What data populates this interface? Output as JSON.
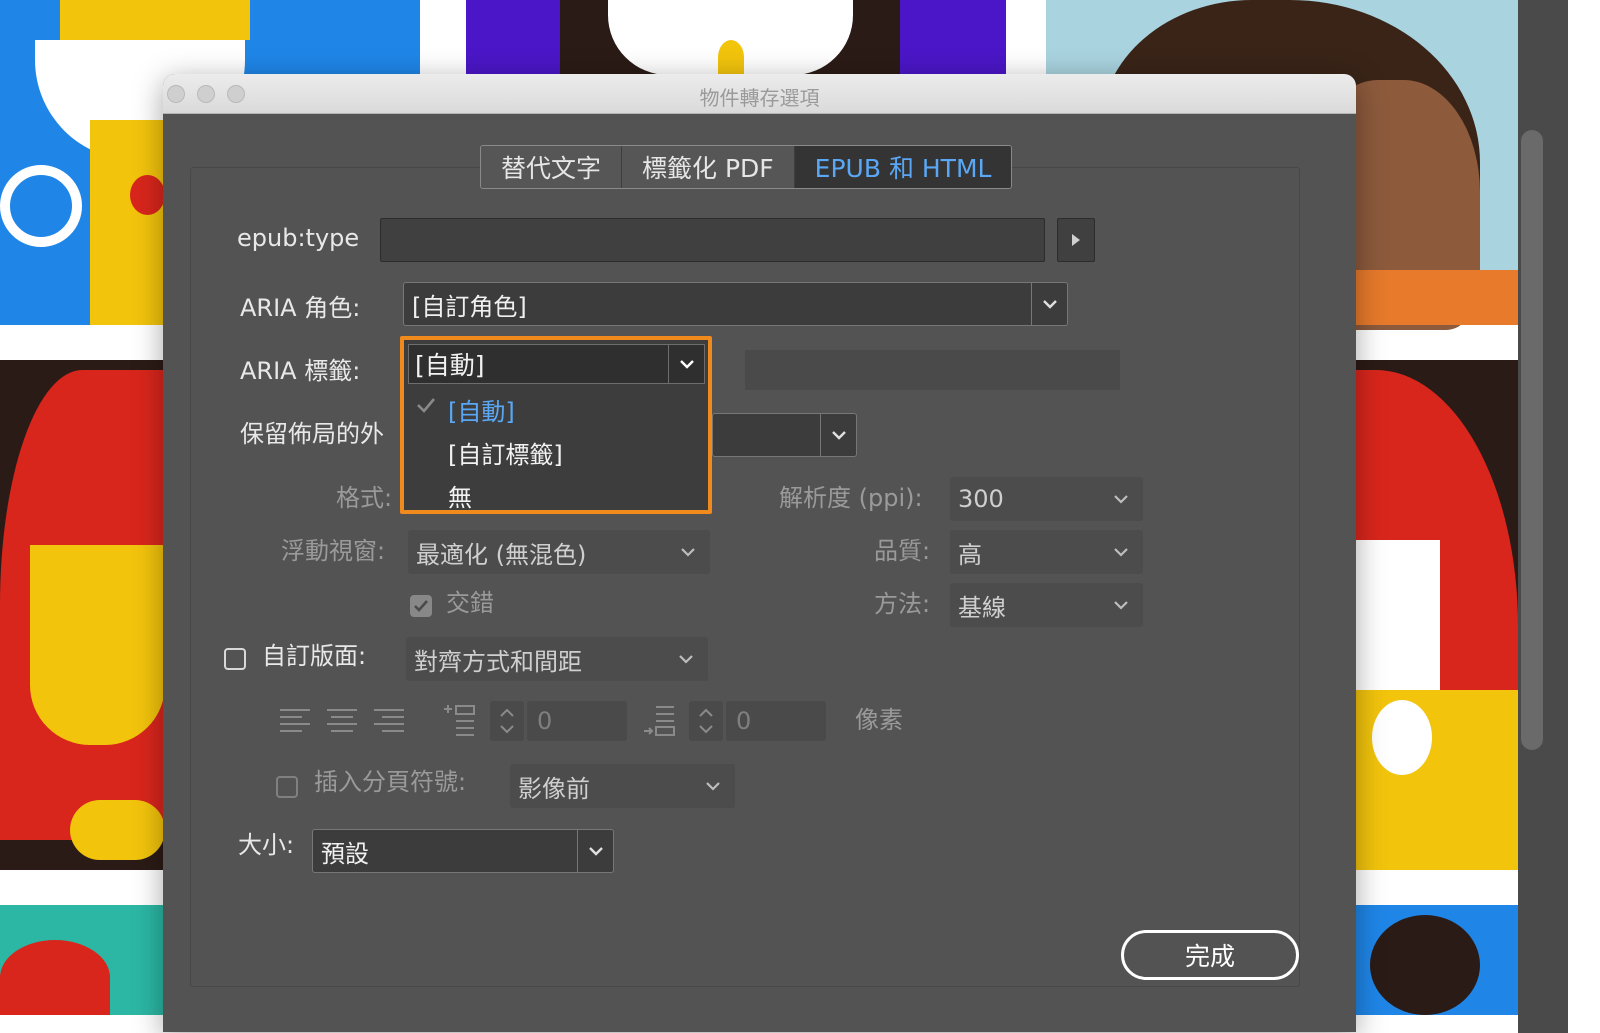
{
  "window": {
    "title": "物件轉存選項"
  },
  "tabs": [
    {
      "label": "替代文字",
      "active": false
    },
    {
      "label": "標籤化 PDF",
      "active": false
    },
    {
      "label": "EPUB 和 HTML",
      "active": true
    }
  ],
  "epub_type": {
    "label": "epub:type",
    "value": ""
  },
  "aria_role": {
    "label": "ARIA 角色:",
    "value": "[自訂角色]"
  },
  "aria_label": {
    "label": "ARIA 標籤:",
    "value": "[自動]",
    "options": [
      "[自動]",
      "[自訂標籤]",
      "無"
    ],
    "selected_index": 0
  },
  "preserve_layout": {
    "label_visible": "保留佈局的外"
  },
  "format": {
    "label": "格式:"
  },
  "resolution": {
    "label": "解析度 (ppi):",
    "value": "300"
  },
  "palette": {
    "label": "浮動視窗:",
    "value": "最適化 (無混色)"
  },
  "quality": {
    "label": "品質:",
    "value": "高"
  },
  "interlace": {
    "label": "交錯",
    "checked": true
  },
  "method": {
    "label": "方法:",
    "value": "基線"
  },
  "custom_layout": {
    "label": "自訂版面:",
    "value": "對齊方式和間距",
    "checked": false
  },
  "spacing": {
    "before": "0",
    "after": "0",
    "unit": "像素"
  },
  "page_break": {
    "label": "插入分頁符號:",
    "value": "影像前",
    "checked": false
  },
  "size": {
    "label": "大小:",
    "value": "預設"
  },
  "done_button": "完成",
  "colors": {
    "dialog_bg": "#535353",
    "accent_blue": "#5aa8f5",
    "highlight_orange": "#f08a1c"
  }
}
